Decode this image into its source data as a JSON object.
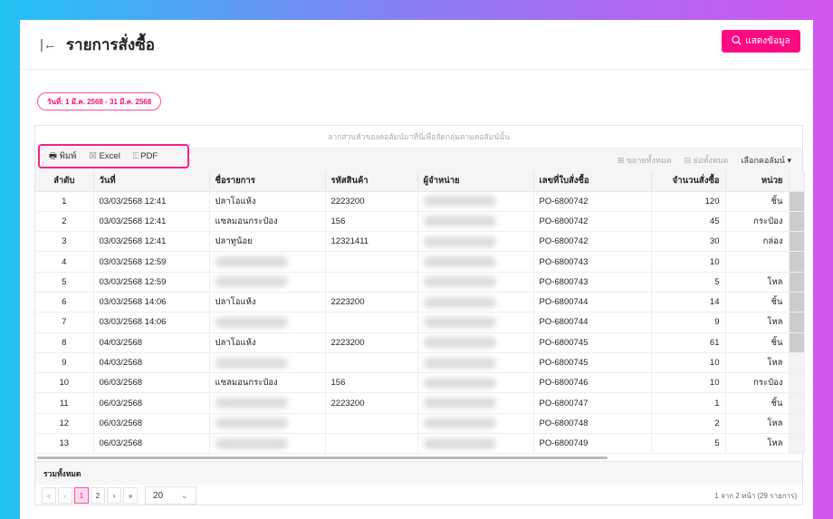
{
  "header": {
    "title": "รายการสั่งซื้อ",
    "show_button": "แสดงข้อมูล"
  },
  "date_filter": "วันที่: 1 มี.ค. 2568 - 31 มี.ค. 2568",
  "grid": {
    "group_hint": "ลากส่วนหัวของคอลัมน์มาที่นี่เพื่อจัดกลุ่มตามคอลัมน์นั้น",
    "export": {
      "print": "พิมพ์",
      "excel": "Excel",
      "pdf": "PDF"
    },
    "expand_all": "ขยายทั้งหมด",
    "collapse_all": "ย่อทั้งหมด",
    "choose_columns": "เลือกคอลัมน์",
    "columns": [
      "ลำดับ",
      "วันที่",
      "ชื่อรายการ",
      "รหัสสินค้า",
      "ผู้จำหน่าย",
      "เลขที่ใบสั่งซื้อ",
      "จำนวนสั่งซื้อ",
      "หน่วย"
    ],
    "rows": [
      [
        "1",
        "03/03/2568 12:41",
        "ปลาโอแห้ง",
        "2223200",
        "",
        "PO-6800742",
        "120",
        "ชิ้น"
      ],
      [
        "2",
        "03/03/2568 12:41",
        "แซลมอนกระป๋อง",
        "156",
        "",
        "PO-6800742",
        "45",
        "กระป๋อง"
      ],
      [
        "3",
        "03/03/2568 12:41",
        "ปลาทูน้อย",
        "12321411",
        "",
        "PO-6800742",
        "30",
        "กล่อง"
      ],
      [
        "4",
        "03/03/2568 12:59",
        "",
        "",
        "",
        "PO-6800743",
        "10",
        ""
      ],
      [
        "5",
        "03/03/2568 12:59",
        "",
        "",
        "",
        "PO-6800743",
        "5",
        "โหล"
      ],
      [
        "6",
        "03/03/2568 14:06",
        "ปลาโอแห้ง",
        "2223200",
        "",
        "PO-6800744",
        "14",
        "ชิ้น"
      ],
      [
        "7",
        "03/03/2568 14:06",
        "",
        "",
        "",
        "PO-6800744",
        "9",
        "โหล"
      ],
      [
        "8",
        "04/03/2568",
        "ปลาโอแห้ง",
        "2223200",
        "",
        "PO-6800745",
        "61",
        "ชิ้น"
      ],
      [
        "9",
        "04/03/2568",
        "",
        "",
        "",
        "PO-6800745",
        "10",
        "โหล"
      ],
      [
        "10",
        "06/03/2568",
        "แซลมอนกระป๋อง",
        "156",
        "",
        "PO-6800746",
        "10",
        "กระป๋อง"
      ],
      [
        "11",
        "06/03/2568",
        "",
        "2223200",
        "",
        "PO-6800747",
        "1",
        "ชิ้น"
      ],
      [
        "12",
        "06/03/2568",
        "",
        "",
        "",
        "PO-6800748",
        "2",
        "โหล"
      ],
      [
        "13",
        "06/03/2568",
        "",
        "",
        "",
        "PO-6800749",
        "5",
        "โหล"
      ]
    ],
    "summary_label": "รวมทั้งหมด",
    "pager": {
      "pages": [
        "1",
        "2"
      ],
      "current": "1",
      "page_size": "20",
      "info": "1 จาก 2 หน้า (29 รายการ)"
    }
  }
}
